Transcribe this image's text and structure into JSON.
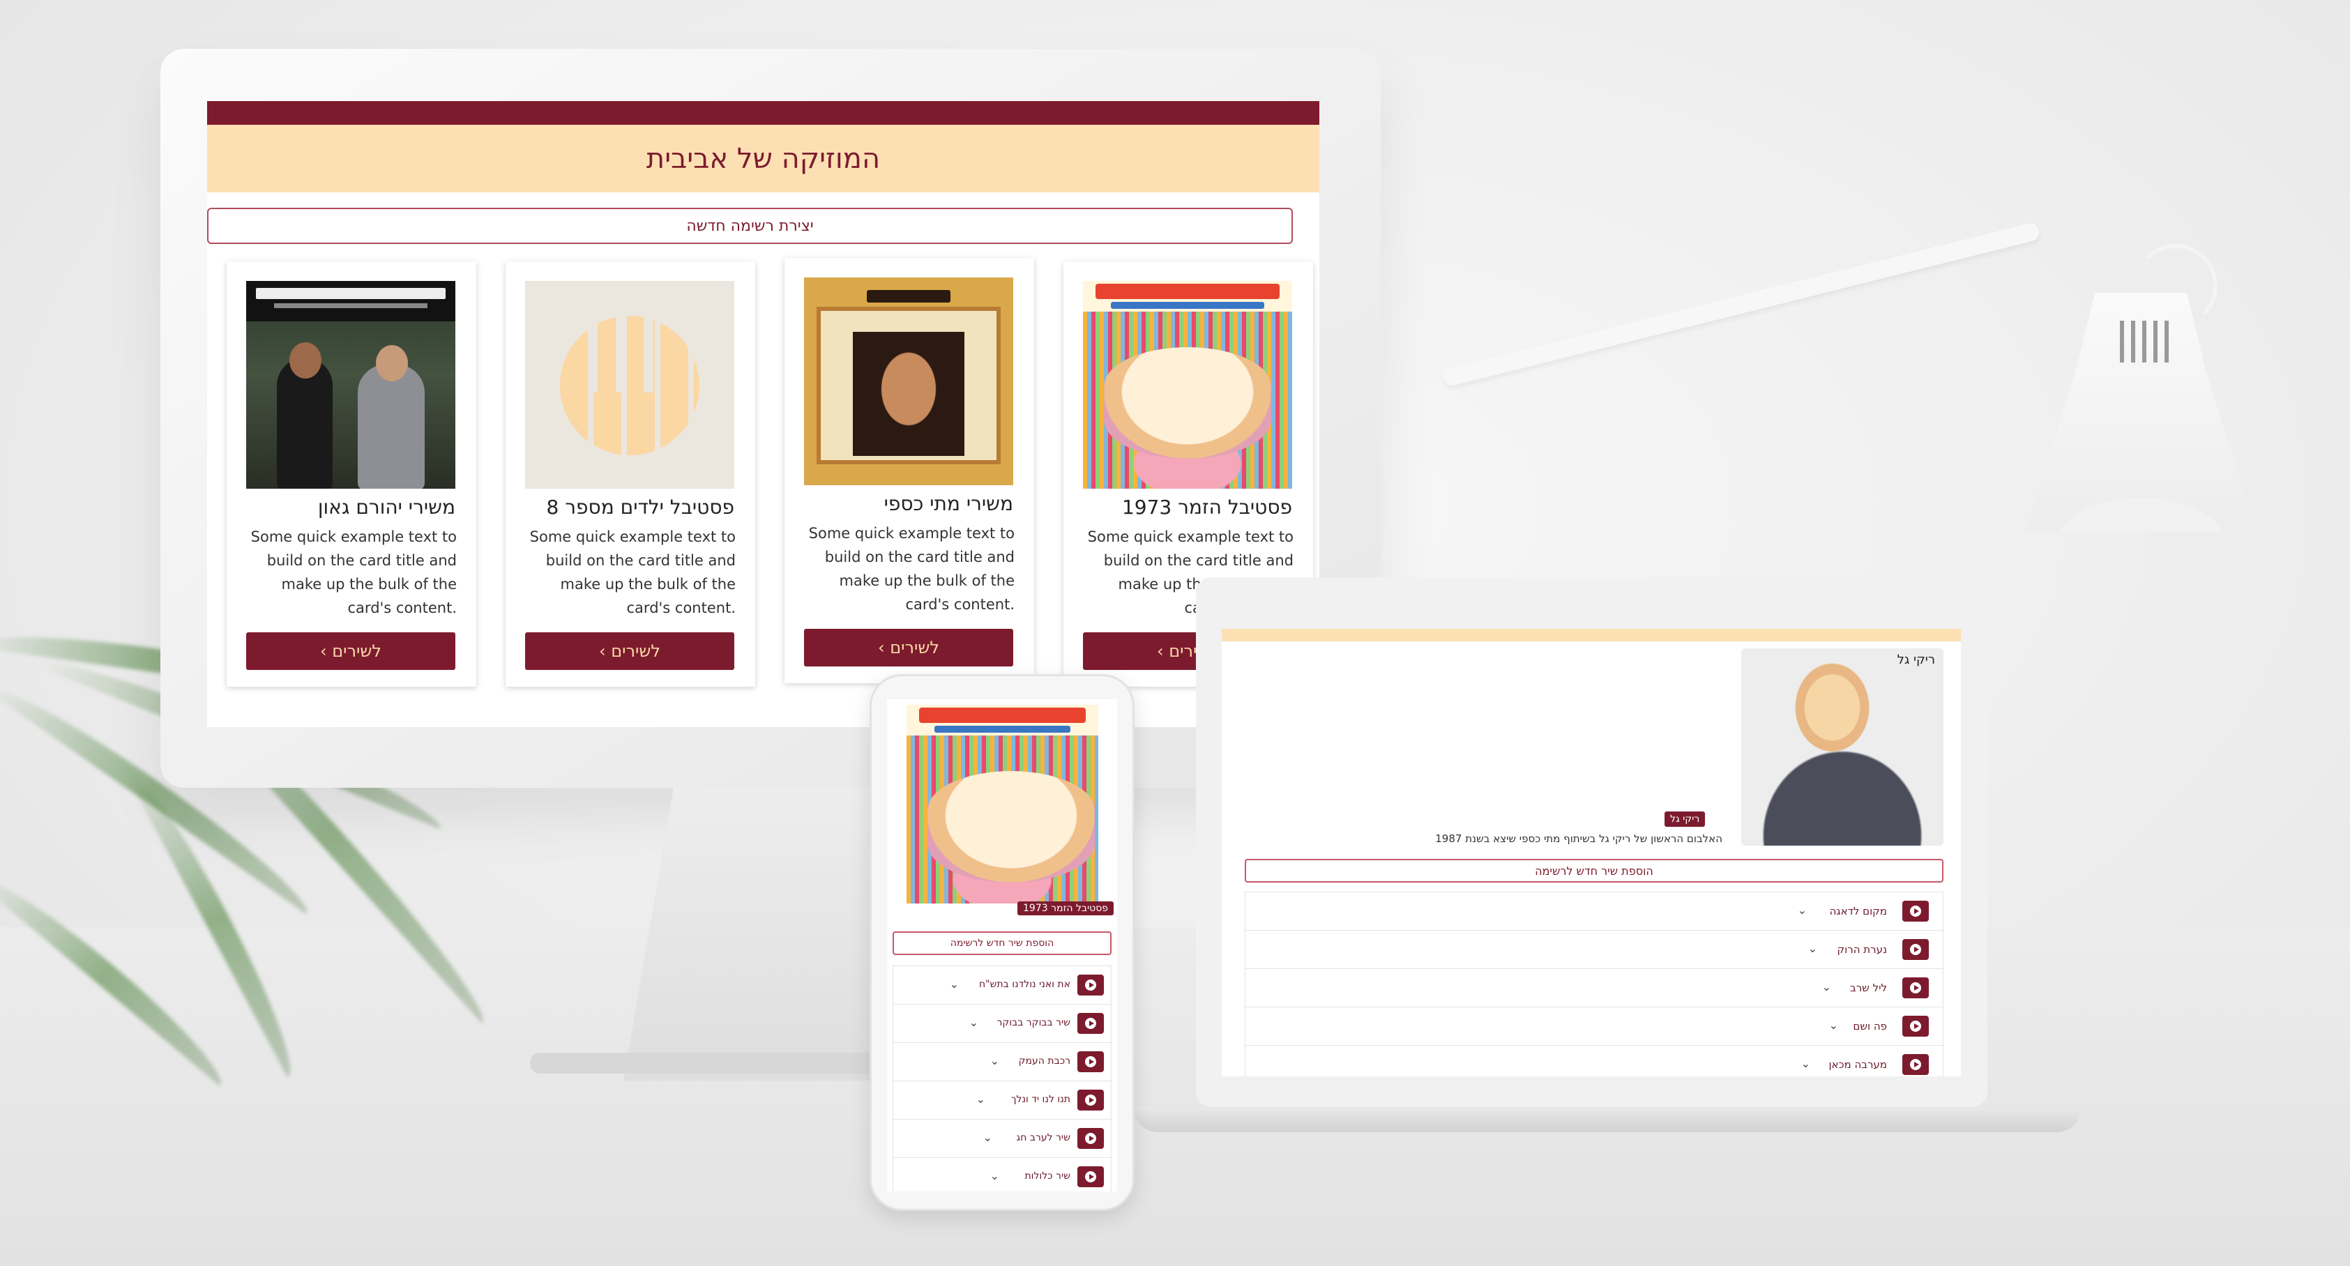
{
  "site": {
    "title": "המוזיקה של אביבית",
    "create_list_label": "יצירת רשימה חדשה"
  },
  "cards": [
    {
      "title": "פסטיבל הזמר 1973",
      "text": "Some quick example text to build on the card title and make up the bulk of the card's content.",
      "button": "לשירים",
      "cover": "festival-1973-cover"
    },
    {
      "title": "משירי מתי כספי",
      "text": "Some quick example text to build on the card title and make up the bulk of the card's content.",
      "button": "לשירים",
      "cover": "matti-caspi-cover"
    },
    {
      "title": "פסטיבל ילדים מספר 8",
      "text": "Some quick example text to build on the card title and make up the bulk of the card's content.",
      "button": "לשירים",
      "cover": "piano-placeholder-cover"
    },
    {
      "title": "משירי יהורם גאון",
      "text": "Some quick example text to build on the card title and make up the bulk of the card's content.",
      "button": "לשירים",
      "cover": "yehoram-gaon-cover"
    }
  ],
  "album_view_laptop": {
    "artist_badge": "ריקי גל",
    "cover_caption": "ריקי גל",
    "description": "האלבום הראשון של ריקי גל בשיתוף מתי כספי שיצא בשנת 1987",
    "add_song_label": "הוספת שיר חדש לרשימה",
    "songs": [
      "מקום לדאגה",
      "נערת הרוק",
      "ליל שרב",
      "פה ושם",
      "מערבה מכאן"
    ]
  },
  "album_view_phone": {
    "album_badge": "פסטיבל הזמר 1973",
    "add_song_label": "הוספת שיר חדש לרשימה",
    "songs": [
      "את ואני נולדנו בתש\"ח",
      "שיר בבוקר בבוקר",
      "רכבת העמק",
      "תנו לנו יד ונלך",
      "שיר לערב חג",
      "שיר כלולות"
    ]
  },
  "icons": {
    "play": "play-circle-icon",
    "chevron": "chevron-down-icon",
    "card_button_chevron": "chevron-left-icon"
  },
  "colors": {
    "brand_dark": "#7d1b2e",
    "brand_light": "#fce0b3"
  }
}
